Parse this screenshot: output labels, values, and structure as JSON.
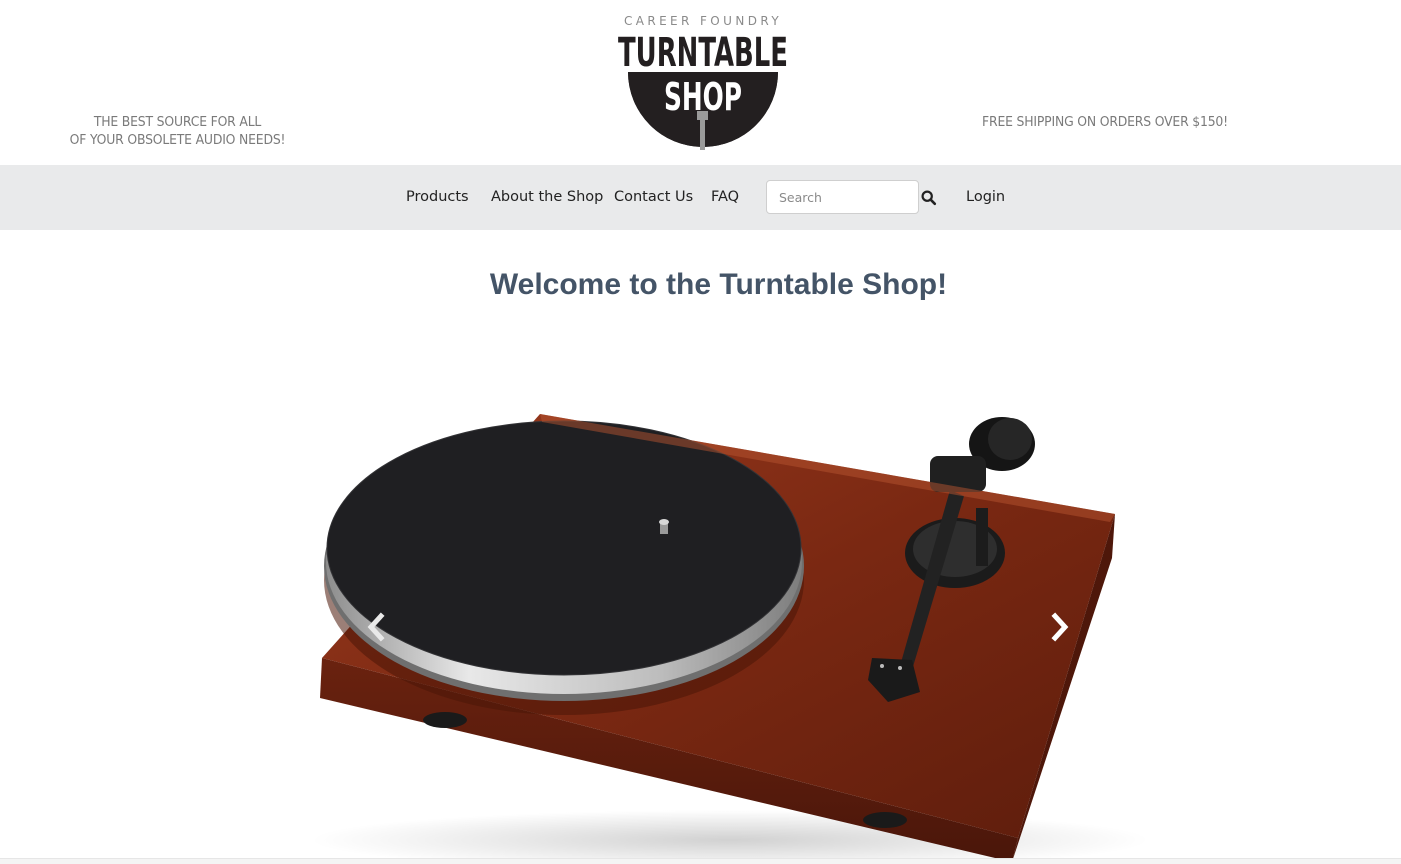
{
  "header": {
    "tagline_left_line1": "THE BEST SOURCE FOR ALL",
    "tagline_left_line2": "OF YOUR OBSOLETE AUDIO NEEDS!",
    "tagline_right": "FREE SHIPPING ON ORDERS OVER $150!",
    "logo": {
      "top_text": "CAREER FOUNDRY",
      "title_line1": "TURNTABLE",
      "title_line2": "SHOP"
    }
  },
  "nav": {
    "items": [
      {
        "label": "Products"
      },
      {
        "label": "About the Shop"
      },
      {
        "label": "Contact Us"
      },
      {
        "label": "FAQ"
      }
    ],
    "search": {
      "placeholder": "Search",
      "icon": "search-icon"
    },
    "login_label": "Login"
  },
  "main": {
    "welcome_title": "Welcome to the Turntable Shop!",
    "carousel": {
      "prev_icon": "chevron-left-icon",
      "next_icon": "chevron-right-icon"
    }
  },
  "colors": {
    "nav_background": "#e9eaeb",
    "heading": "#445467",
    "plinth": "#7a2a14",
    "platter_mat": "#1f1f22"
  }
}
